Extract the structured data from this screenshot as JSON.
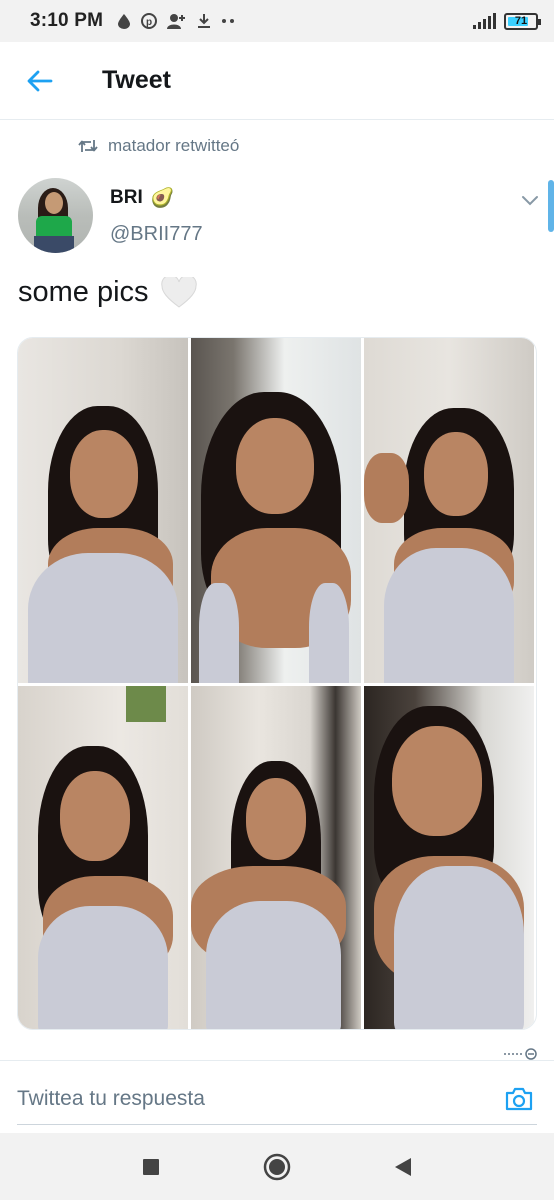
{
  "status_bar": {
    "time": "3:10 PM",
    "battery": "71",
    "icons": [
      "drop-icon",
      "pinterest-icon",
      "add-user-icon",
      "download-icon",
      "more-dots-icon",
      "signal-icon",
      "battery-icon"
    ]
  },
  "header": {
    "title": "Tweet",
    "back_icon": "arrow-left-icon"
  },
  "tweet": {
    "retweet_text": "matador retwitteó",
    "author_name": "BRI",
    "author_emoji": "🥑",
    "author_handle": "@BRII777",
    "text": "some pics",
    "text_emoji": "🤍",
    "media_count": 6
  },
  "reply": {
    "placeholder": "Twittea tu respuesta"
  },
  "colors": {
    "accent": "#1da1f2",
    "secondary_text": "#657786",
    "primary_text": "#14171a"
  }
}
